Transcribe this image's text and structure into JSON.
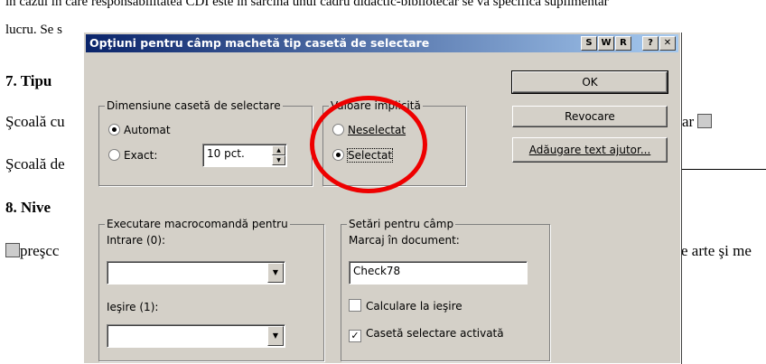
{
  "background_doc": {
    "line1": "în cazul în care responsabilitatea CDI este în sarcina unui cadru didactic-bibliotecar se va specifica suplimentar",
    "line2": "lucru. Se s",
    "heading7": "7.  Tipu",
    "row1_left": "Şcoală cu",
    "row1_right": "ar",
    "row2_left": "Şcoală de",
    "heading8": "8.  Nive",
    "row3_left": "preşcc",
    "row3_right": "e arte şi me"
  },
  "dialog": {
    "title": "Opţiuni pentru câmp machetă tip casetă de selectare",
    "title_buttons": [
      "S",
      "W",
      "R",
      "?",
      "✕"
    ],
    "buttons": {
      "ok": "OK",
      "cancel": "Revocare",
      "help": "Adăugare text ajutor..."
    },
    "size_group": {
      "legend": "Dimensiune casetă de selectare",
      "auto_label": "Automat",
      "exact_label": "Exact:",
      "exact_value": "10 pct.",
      "selected": "auto"
    },
    "default_group": {
      "legend": "Valoare implicită",
      "unchecked_label": "Neselectat",
      "checked_label": "Selectat",
      "selected": "checked"
    },
    "macro_group": {
      "legend": "Executare macrocomandă pentru",
      "entry_label": "Intrare (0):",
      "exit_label": "Ieşire (1):",
      "entry_value": "",
      "exit_value": ""
    },
    "settings_group": {
      "legend": "Setări pentru câmp",
      "bookmark_label": "Marcaj în document:",
      "bookmark_value": "Check78",
      "calc_on_exit_label": "Calculare la ieşire",
      "calc_on_exit_checked": false,
      "enabled_label": "Casetă selectare activată",
      "enabled_checked": true
    },
    "annotation_color": "#ee0000"
  }
}
